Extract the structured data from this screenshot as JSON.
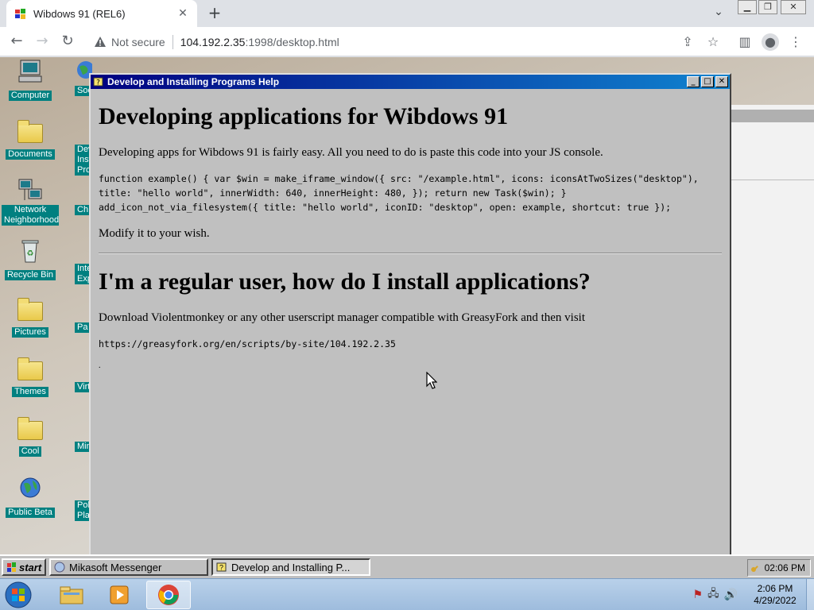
{
  "browser": {
    "tab_title": "Wibdows 91 (REL6)",
    "not_secure": "Not secure",
    "url_host": "104.192.2.35",
    "url_path": ":1998/desktop.html"
  },
  "desktop": {
    "icons": [
      {
        "label": "Computer"
      },
      {
        "label": "Documents"
      },
      {
        "label": "Network Neighborhood"
      },
      {
        "label": "Recycle Bin"
      },
      {
        "label": "Pictures"
      },
      {
        "label": "Themes"
      },
      {
        "label": "Cool"
      },
      {
        "label": "Public Beta"
      }
    ],
    "col2_labels": [
      "Soc",
      "Deve",
      "Ch",
      "Inte",
      "Pa",
      "Virtual I",
      "Mine",
      "Poke"
    ],
    "col2_extra": [
      "Inst",
      "Prog",
      "Expl",
      "Plat"
    ]
  },
  "help_window": {
    "title": "Develop and Installing Programs Help",
    "h1": "Developing applications for Wibdows 91",
    "p1": "Developing apps for Wibdows 91 is fairly easy. All you need to do is paste this code into your JS console.",
    "code": "function example() { var $win = make_iframe_window({ src: \"/example.html\", icons: iconsAtTwoSizes(\"desktop\"), title: \"hello world\", innerWidth: 640, innerHeight: 480, }); return new Task($win); } add_icon_not_via_filesystem({ title: \"hello world\", iconID: \"desktop\", open: example, shortcut: true });",
    "p2": "Modify it to your wish.",
    "h2": "I'm a regular user, how do I install applications?",
    "p3": "Download Violentmonkey or any other userscript manager compatible with GreasyFork and then visit",
    "link": "https://greasyfork.org/en/scripts/by-site/104.192.2.35",
    "dot": "."
  },
  "w91_taskbar": {
    "start": "start",
    "items": [
      "Mikasoft Messenger",
      "Develop and Installing P..."
    ],
    "clock": "02:06 PM"
  },
  "w7_taskbar": {
    "time": "2:06 PM",
    "date": "4/29/2022"
  }
}
